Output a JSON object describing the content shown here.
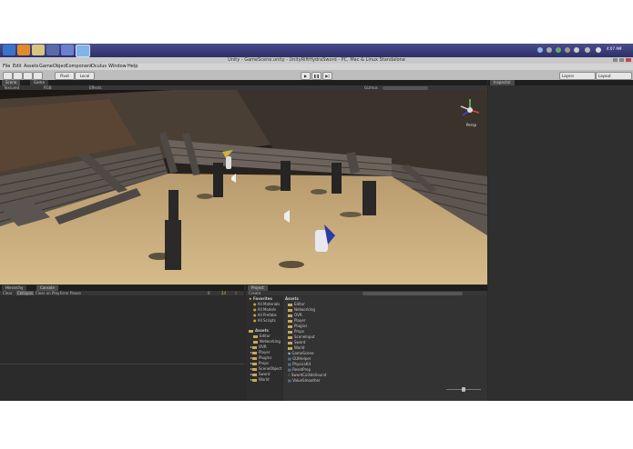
{
  "window": {
    "title": "Unity - GameScene.unity - UnityRiftHydraSword - PC, Mac & Linux Standalone"
  },
  "clock": "4:07 AM",
  "menu": [
    "File",
    "Edit",
    "Assets",
    "GameObject",
    "Component",
    "Oculus",
    "Window",
    "Help"
  ],
  "toolbar": {
    "pivot": "Pivot",
    "local": "Local",
    "layers": "Layers",
    "layout": "Layout"
  },
  "scene_tabs": {
    "scene": "Scene",
    "game": "Game",
    "shading": "Textured",
    "mode": "RGB",
    "effects": "Effects",
    "gizmos": "Gizmos",
    "persp": "Persp"
  },
  "inspector": {
    "tab": "Inspector"
  },
  "hierarchy": {
    "tab": "Hierarchy",
    "console_tab": "Console",
    "clear": "Clear",
    "collapse": "Collapse",
    "clear_on_play": "Clear on Play",
    "error_pause": "Error Pause",
    "counts": [
      "0",
      "24",
      "0"
    ]
  },
  "project": {
    "tab": "Project",
    "create": "Create",
    "favorites_label": "Favorites",
    "favorites": [
      "All Materials",
      "All Models",
      "All Prefabs",
      "All Scripts"
    ],
    "assets_label": "Assets",
    "tree": [
      "Editor",
      "Networking",
      "OVR",
      "Player",
      "Plugins",
      "Props",
      "SceneObject",
      "Sword",
      "World"
    ],
    "assets_header": "Assets",
    "files": [
      "Editor",
      "Networking",
      "OVR",
      "Player",
      "Plugins",
      "Props",
      "SceneInput",
      "Sword",
      "World",
      "GameScene",
      "GUIHelper",
      "PhysicsKit",
      "ResetProp",
      "SwordCollideSound",
      "ValueSmoother"
    ]
  }
}
